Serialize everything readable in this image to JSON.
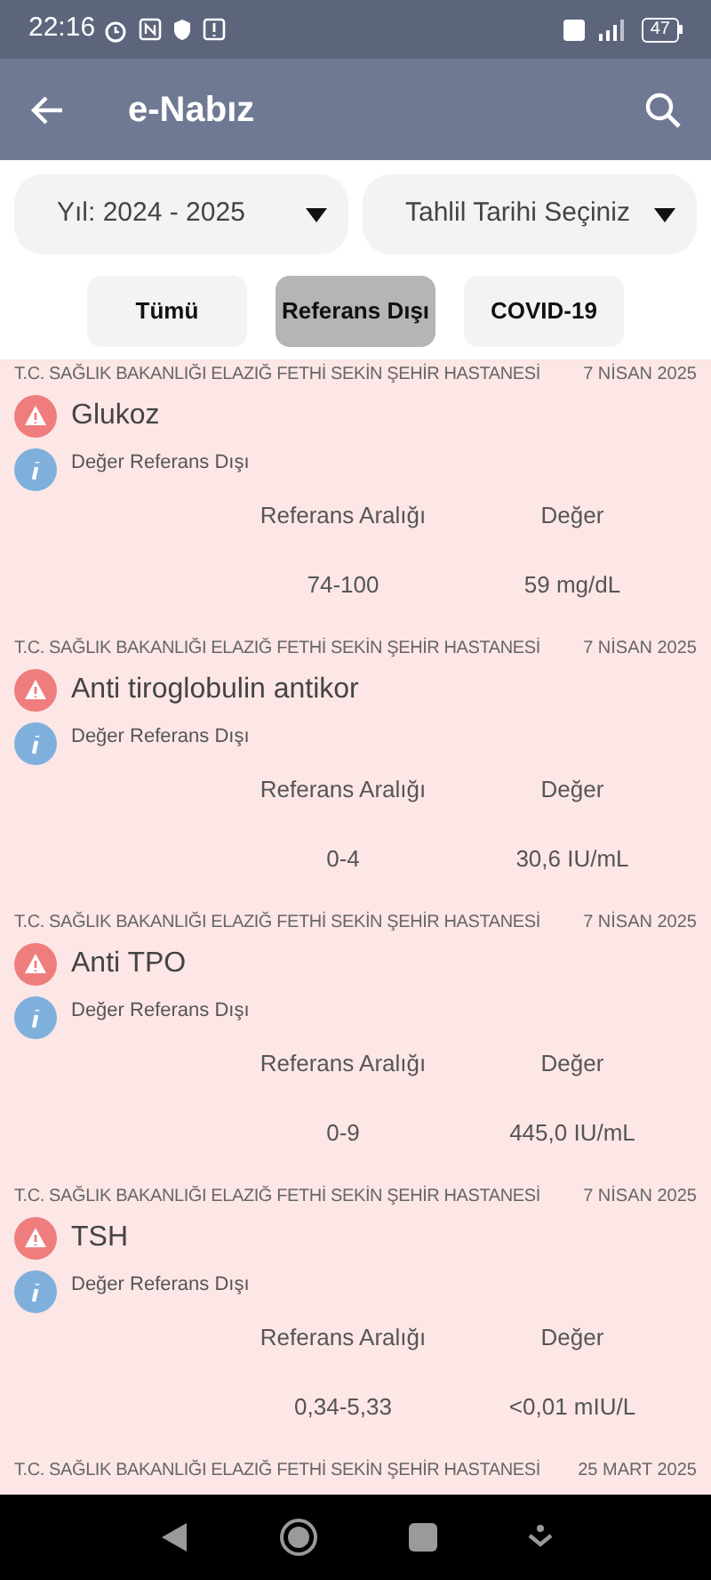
{
  "status_bar": {
    "time": "22:16",
    "battery": "47"
  },
  "app_bar": {
    "title": "e-Nabız"
  },
  "filters": [
    {
      "value": "Yıl: 2024 - 2025"
    },
    {
      "value": "Tahlil Tarihi Seçiniz"
    }
  ],
  "tabs": [
    {
      "label": "Tümü",
      "selected": false
    },
    {
      "label": "Referans Dışı",
      "selected": true
    },
    {
      "label": "COVID-19",
      "selected": false
    }
  ],
  "results": [
    {
      "hospital": "T.C. SAĞLIK BAKANLIĞI ELAZIĞ FETHİ SEKİN ŞEHİR HASTANESİ",
      "date": "7 NİSAN 2025",
      "test": "Glukoz",
      "note": "Değer Referans Dışı",
      "range_label": "Referans Aralığı",
      "value_label": "Değer",
      "range": "74-100",
      "value": "59 mg/dL"
    },
    {
      "hospital": "T.C. SAĞLIK BAKANLIĞI ELAZIĞ FETHİ SEKİN ŞEHİR HASTANESİ",
      "date": "7 NİSAN 2025",
      "test": "Anti tiroglobulin antikor",
      "note": "Değer Referans Dışı",
      "range_label": "Referans Aralığı",
      "value_label": "Değer",
      "range": "0-4",
      "value": "30,6 IU/mL"
    },
    {
      "hospital": "T.C. SAĞLIK BAKANLIĞI ELAZIĞ FETHİ SEKİN ŞEHİR HASTANESİ",
      "date": "7 NİSAN 2025",
      "test": "Anti TPO",
      "note": "Değer Referans Dışı",
      "range_label": "Referans Aralığı",
      "value_label": "Değer",
      "range": "0-9",
      "value": "445,0 IU/mL"
    },
    {
      "hospital": "T.C. SAĞLIK BAKANLIĞI ELAZIĞ FETHİ SEKİN ŞEHİR HASTANESİ",
      "date": "7 NİSAN 2025",
      "test": "TSH",
      "note": "Değer Referans Dışı",
      "range_label": "Referans Aralığı",
      "value_label": "Değer",
      "range": "0,34-5,33",
      "value": "<0,01 mIU/L"
    },
    {
      "hospital": "T.C. SAĞLIK BAKANLIĞI ELAZIĞ FETHİ SEKİN ŞEHİR HASTANESİ",
      "date": "25 MART 2025"
    }
  ]
}
